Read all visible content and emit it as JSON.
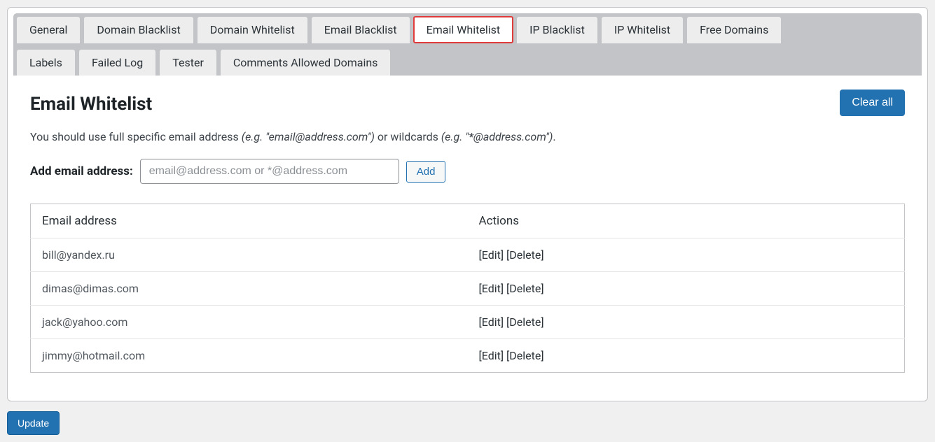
{
  "tabs": {
    "row1": [
      {
        "id": "general",
        "label": "General",
        "active": false
      },
      {
        "id": "domain-blacklist",
        "label": "Domain Blacklist",
        "active": false
      },
      {
        "id": "domain-whitelist",
        "label": "Domain Whitelist",
        "active": false
      },
      {
        "id": "email-blacklist",
        "label": "Email Blacklist",
        "active": false
      },
      {
        "id": "email-whitelist",
        "label": "Email Whitelist",
        "active": true
      },
      {
        "id": "ip-blacklist",
        "label": "IP Blacklist",
        "active": false
      },
      {
        "id": "ip-whitelist",
        "label": "IP Whitelist",
        "active": false
      },
      {
        "id": "free-domains",
        "label": "Free Domains",
        "active": false
      }
    ],
    "row2": [
      {
        "id": "labels",
        "label": "Labels",
        "active": false
      },
      {
        "id": "failed-log",
        "label": "Failed Log",
        "active": false
      },
      {
        "id": "tester",
        "label": "Tester",
        "active": false
      },
      {
        "id": "comments-allowed-domains",
        "label": "Comments Allowed Domains",
        "active": false
      }
    ]
  },
  "page": {
    "title": "Email Whitelist",
    "clear_all": "Clear all",
    "description_pre": "You should use full specific email address ",
    "description_ex1": "(e.g. \"email@address.com\")",
    "description_mid": " or wildcards ",
    "description_ex2": "(e.g. \"*@address.com\")",
    "description_post": "."
  },
  "form": {
    "add_label": "Add email address:",
    "placeholder": "email@address.com or *@address.com",
    "add_button": "Add"
  },
  "table": {
    "col_email": "Email address",
    "col_actions": "Actions",
    "rows": [
      {
        "email": "bill@yandex.ru"
      },
      {
        "email": "dimas@dimas.com"
      },
      {
        "email": "jack@yahoo.com"
      },
      {
        "email": "jimmy@hotmail.com"
      }
    ],
    "edit_label": "[Edit]",
    "delete_label": "[Delete]"
  },
  "footer": {
    "update": "Update"
  }
}
